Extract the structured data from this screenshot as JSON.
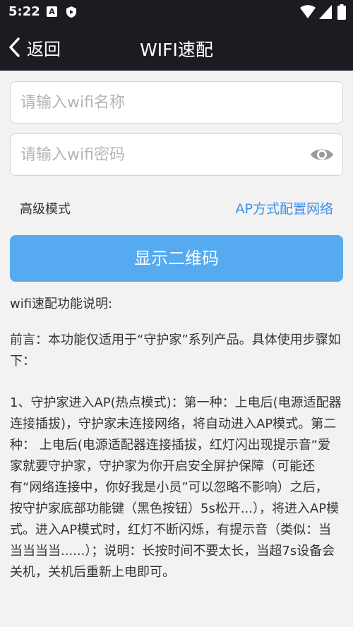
{
  "status_bar": {
    "time": "5:22",
    "a_badge": "A",
    "icons": [
      "a-icon",
      "shield-icon",
      "wifi-icon",
      "signal-icon",
      "battery-icon"
    ]
  },
  "nav": {
    "back_label": "返回",
    "title": "WIFI速配"
  },
  "form": {
    "ssid_value": "",
    "ssid_placeholder": "请输入wifi名称",
    "password_value": "",
    "password_placeholder": "请输入wifi密码",
    "password_toggle_icon": "eye-icon",
    "advanced_label": "高级模式",
    "ap_link": "AP方式配置网络",
    "qr_button": "显示二维码"
  },
  "description": {
    "heading": "wifi速配功能说明:",
    "intro": "前言：本功能仅适用于“守护家”系列产品。具体使用步骤如下：",
    "step1": "1、守护家进入AP(热点模式)：第一种：上电后(电源适配器连接插拔)，守护家未连接网络，将自动进入AP模式。第二种： 上电后(电源适配器连接插拔，红灯闪出现提示音“爱家就要守护家，守护家为你开启安全屏护保障（可能还有“网络连接中，你好我是小员”可以忽略不影响）之后， 按守护家底部功能键（黑色按钮）5s松开...），将进入AP模式。进入AP模式时，红灯不断闪烁，有提示音（类似：当当当当当......）；说明：长按时间不要太长，当超7s设备会关机，关机后重新上电即可。"
  },
  "colors": {
    "header_bg": "#1b1c22",
    "page_bg": "#f2f2f2",
    "accent_button": "#55aaf0",
    "link": "#3d8ee8"
  }
}
